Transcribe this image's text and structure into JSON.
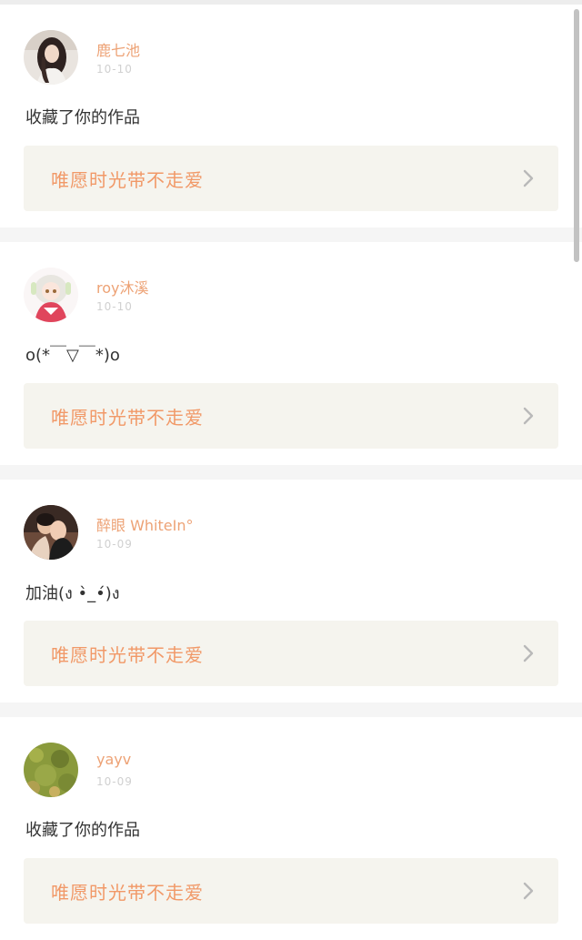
{
  "feed": {
    "items": [
      {
        "username": "鹿七池",
        "date": "10-10",
        "message": "收藏了你的作品",
        "work_title": "唯愿时光带不走爱",
        "avatar_icon": "avatar-girl-long-hair"
      },
      {
        "username": "roy沐溪",
        "date": "10-10",
        "message": "o(*￣▽￣*)o",
        "work_title": "唯愿时光带不走爱",
        "avatar_icon": "avatar-anime-girl"
      },
      {
        "username": "醉眼 WhiteIn°",
        "date": "10-09",
        "message": "加油(ง •̀_•́)ง",
        "work_title": "唯愿时光带不走爱",
        "avatar_icon": "avatar-couple"
      },
      {
        "username": "yayv",
        "date": "10-09",
        "message": "收藏了你的作品",
        "work_title": "唯愿时光带不走爱",
        "avatar_icon": "avatar-green-field"
      }
    ]
  },
  "colors": {
    "username": "#eda275",
    "date": "#d0d0d0",
    "work_title": "#f19968",
    "work_bg": "#f5f4ee",
    "gap_bg": "#f5f5f5"
  }
}
